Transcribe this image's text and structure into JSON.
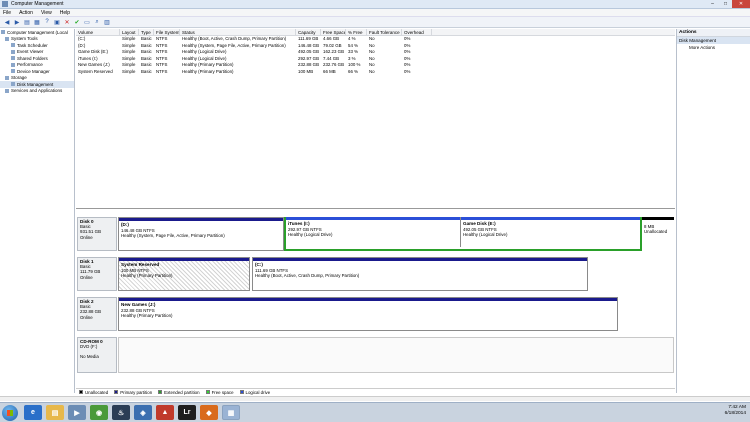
{
  "window": {
    "title": "Computer Management"
  },
  "menu": [
    "File",
    "Action",
    "View",
    "Help"
  ],
  "tree": [
    {
      "label": "Computer Management (Local",
      "indent": 0
    },
    {
      "label": "System Tools",
      "indent": 1
    },
    {
      "label": "Task Scheduler",
      "indent": 2
    },
    {
      "label": "Event Viewer",
      "indent": 2
    },
    {
      "label": "Shared Folders",
      "indent": 2
    },
    {
      "label": "Performance",
      "indent": 2
    },
    {
      "label": "Device Manager",
      "indent": 2
    },
    {
      "label": "Storage",
      "indent": 1
    },
    {
      "label": "Disk Management",
      "indent": 2,
      "selected": true
    },
    {
      "label": "Services and Applications",
      "indent": 1
    }
  ],
  "volumes": {
    "headers": [
      "Volume",
      "Layout",
      "Type",
      "File System",
      "Status",
      "Capacity",
      "Free Space",
      "% Free",
      "Fault Tolerance",
      "Overhead"
    ],
    "rows": [
      [
        "(C:)",
        "Simple",
        "Basic",
        "NTFS",
        "Healthy (Boot, Active, Crash Dump, Primary Partition)",
        "111.69 GB",
        "4.66 GB",
        "4 %",
        "No",
        "0%"
      ],
      [
        "(D:)",
        "Simple",
        "Basic",
        "NTFS",
        "Healthy (System, Page File, Active, Primary Partition)",
        "146.48 GB",
        "79.02 GB",
        "54 %",
        "No",
        "0%"
      ],
      [
        "Game Disk (E:)",
        "Simple",
        "Basic",
        "NTFS",
        "Healthy (Logical Drive)",
        "492.05 GB",
        "162.23 GB",
        "33 %",
        "No",
        "0%"
      ],
      [
        "iTunes (I:)",
        "Simple",
        "Basic",
        "NTFS",
        "Healthy (Logical Drive)",
        "292.97 GB",
        "7.44 GB",
        "3 %",
        "No",
        "0%"
      ],
      [
        "New Games (J:)",
        "Simple",
        "Basic",
        "NTFS",
        "Healthy (Primary Partition)",
        "232.88 GB",
        "232.76 GB",
        "100 %",
        "No",
        "0%"
      ],
      [
        "System Reserved",
        "Simple",
        "Basic",
        "NTFS",
        "Healthy (Primary Partition)",
        "100 MB",
        "66 MB",
        "66 %",
        "No",
        "0%"
      ]
    ]
  },
  "disks": {
    "disk0": {
      "label": [
        "Disk 0",
        "Basic",
        "931.51 GB",
        "Online"
      ],
      "p_d": {
        "name": "(D:)",
        "size": "146.48 GB NTFS",
        "status": "Healthy (System, Page File, Active, Primary Partition)"
      },
      "p_itunes": {
        "name": "iTunes (I:)",
        "size": "292.97 GB NTFS",
        "status": "Healthy (Logical Drive)"
      },
      "p_game": {
        "name": "Game Disk (E:)",
        "size": "492.05 GB NTFS",
        "status": "Healthy (Logical Drive)"
      },
      "p_unalloc": {
        "size": "8 MB",
        "status": "Unallocated"
      }
    },
    "disk1": {
      "label": [
        "Disk 1",
        "Basic",
        "111.79 GB",
        "Online"
      ],
      "p_sysres": {
        "name": "System Reserved",
        "size": "100 MB NTFS",
        "status": "Healthy (Primary Partition)"
      },
      "p_c": {
        "name": "(C:)",
        "size": "111.69 GB NTFS",
        "status": "Healthy (Boot, Active, Crash Dump, Primary Partition)"
      }
    },
    "disk2": {
      "label": [
        "Disk 2",
        "Basic",
        "232.88 GB",
        "Online"
      ],
      "p_j": {
        "name": "New Games (J:)",
        "size": "232.88 GB NTFS",
        "status": "Healthy (Primary Partition)"
      }
    },
    "cdrom0": {
      "label": [
        "CD-ROM 0",
        "DVD (F:)",
        "",
        "No Media"
      ]
    }
  },
  "legend": [
    {
      "label": "Unallocated",
      "color": "#000000"
    },
    {
      "label": "Primary partition",
      "color": "#1a1a8c"
    },
    {
      "label": "Extended partition",
      "color": "#2aa02a"
    },
    {
      "label": "Free space",
      "color": "#33d433"
    },
    {
      "label": "Logical drive",
      "color": "#2b4fd8"
    }
  ],
  "actions": {
    "header": "Actions",
    "section": "Disk Management",
    "item": "More Actions"
  },
  "taskbar": {
    "time": "7:42 AM",
    "date": "6/18/2014"
  }
}
